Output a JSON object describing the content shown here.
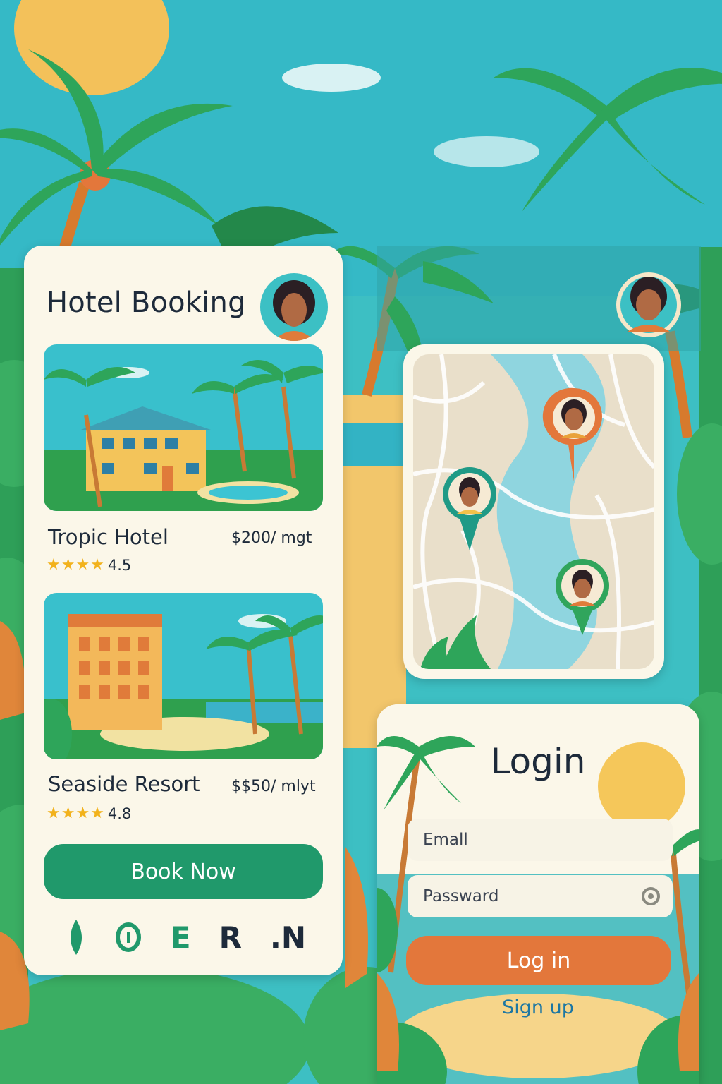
{
  "theme": {
    "accent": "#20996b",
    "secondary": "#e3773b",
    "link": "#1d77a3",
    "star": "#f2b21c"
  },
  "hotel_booking": {
    "title": "Hotel Booking",
    "avatar_icon": "user-avatar",
    "listings": [
      {
        "name": "Tropic Hotel",
        "price": "$200/ mgt",
        "rating": "4.5",
        "stars": "★★★★"
      },
      {
        "name": "Seaside Resort",
        "price": "$$50/ mlyt",
        "rating": "4.8",
        "stars": "★★★★"
      }
    ],
    "book_button": "Book Now",
    "bottom_nav": [
      {
        "icon": "leaf-icon",
        "label": ""
      },
      {
        "icon": "info-icon",
        "label": ""
      },
      {
        "icon": "e-icon",
        "label": "E"
      },
      {
        "icon": "r-icon",
        "label": "R"
      },
      {
        "icon": "n-icon",
        "label": ".N"
      }
    ]
  },
  "map": {
    "pins": [
      {
        "color": "#e3773b",
        "icon": "user-pin-icon"
      },
      {
        "color": "#1f9a86",
        "icon": "user-pin-icon"
      },
      {
        "color": "#30a55c",
        "icon": "user-pin-icon"
      }
    ]
  },
  "login": {
    "title": "Login",
    "email_placeholder": "Emall",
    "password_placeholder": "Passward",
    "login_button": "Log in",
    "signup_link": "Sign up"
  }
}
